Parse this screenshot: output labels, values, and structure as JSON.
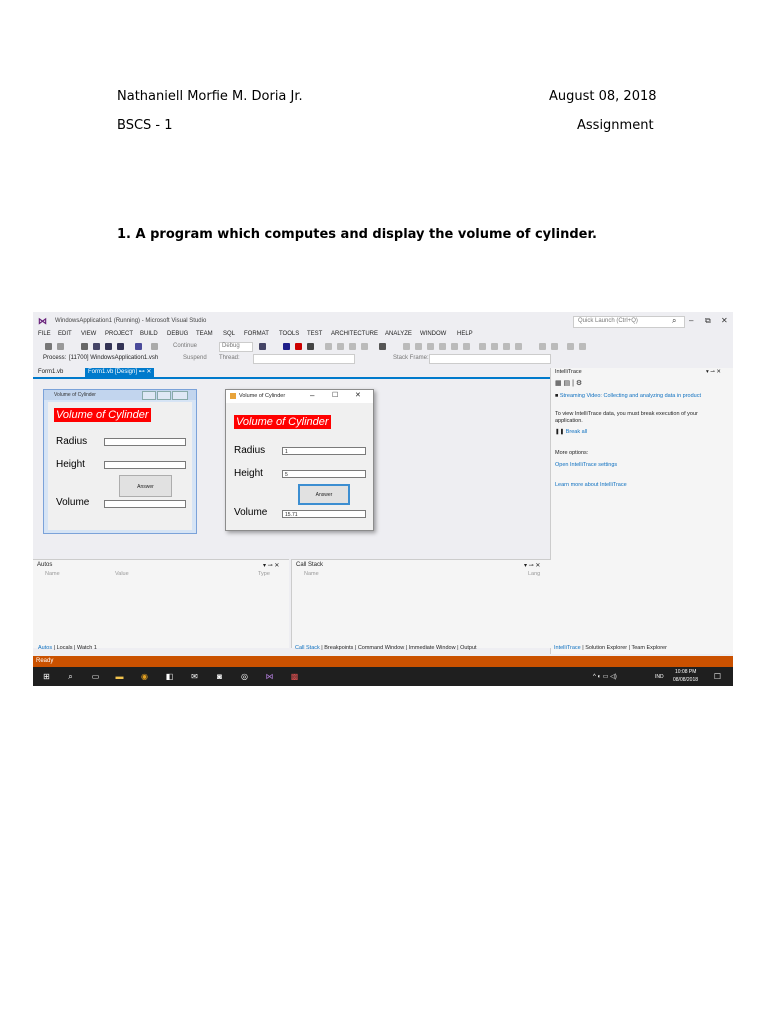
{
  "header": {
    "name": "Nathaniell Morfie M. Doria Jr.",
    "date": "August 08, 2018",
    "course": "BSCS - 1",
    "type": "Assignment"
  },
  "question": "1. A program which computes and display the volume of cylinder.",
  "screenshot": {
    "window_title": "WindowsApplication1 (Running) - Microsoft Visual Studio",
    "quick_launch": "Quick Launch (Ctrl+Q)",
    "menu": [
      "FILE",
      "EDIT",
      "VIEW",
      "PROJECT",
      "BUILD",
      "DEBUG",
      "TEAM",
      "SQL",
      "FORMAT",
      "TOOLS",
      "TEST",
      "ARCHITECTURE",
      "ANALYZE",
      "WINDOW",
      "HELP"
    ],
    "toolbar": {
      "continue": "Continue",
      "config": "Debug",
      "process_label": "Process:",
      "process_value": "[11700] WindowsApplication1.vsh",
      "suspend": "Suspend",
      "thread": "Thread:",
      "stack_frame": "Stack Frame:"
    },
    "tabs": [
      "Form1.vb",
      "Form1.vb [Design]"
    ],
    "design_form": {
      "title": "Volume of Cylinder",
      "banner": "Volume of Cylinder",
      "radius_label": "Radius",
      "height_label": "Height",
      "volume_label": "Volume",
      "button": "Answer"
    },
    "run_form": {
      "title": "Volume of Cylinder",
      "banner": "Volume of Cylinder",
      "radius_label": "Radius",
      "radius_value": "1",
      "height_label": "Height",
      "height_value": "5",
      "volume_label": "Volume",
      "volume_value": "15.71",
      "button": "Answer"
    },
    "intellitrace": {
      "title": "IntelliTrace",
      "video": "Streaming Video: Collecting and analyzing data in product",
      "info": "To view IntelliTrace data, you must break execution of your",
      "info2": "application.",
      "break_all": "Break all",
      "more_options": "More options:",
      "settings": "Open IntelliTrace settings",
      "learn_more": "Learn more about IntelliTrace"
    },
    "autos": {
      "title": "Autos",
      "col_name": "Name",
      "col_value": "Value",
      "col_type": "Type"
    },
    "callstack": {
      "title": "Call Stack",
      "col_name": "Name",
      "col_lang": "Lang"
    },
    "bottom_tabs_left": [
      "Autos",
      "Locals",
      "Watch 1"
    ],
    "bottom_tabs_mid": [
      "Call Stack",
      "Breakpoints",
      "Command Window",
      "Immediate Window",
      "Output"
    ],
    "bottom_tabs_right": [
      "IntelliTrace",
      "Solution Explorer",
      "Team Explorer"
    ],
    "status": "Ready",
    "taskbar": {
      "lang": "IND",
      "time": "10:08 PM",
      "date": "08/08/2018"
    }
  }
}
